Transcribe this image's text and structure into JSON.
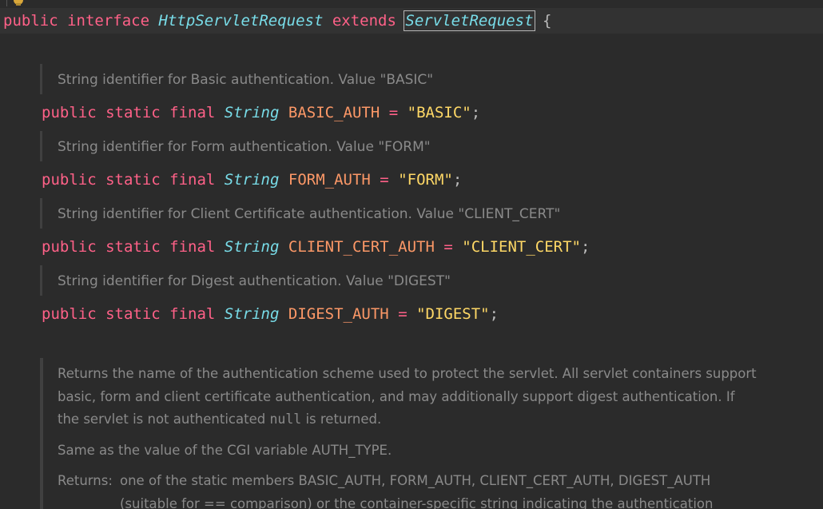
{
  "editor": {
    "declaration": {
      "kw_public": "public",
      "kw_interface": "interface",
      "name": "HttpServletRequest",
      "kw_extends": "extends",
      "parent": "ServletRequest",
      "brace": "{"
    },
    "fields": [
      {
        "doc": "String identifier for Basic authentication. Value \"BASIC\"",
        "mods": "public static final",
        "type": "String",
        "name": "BASIC_AUTH",
        "eq": "=",
        "value": "\"BASIC\"",
        "semi": ";"
      },
      {
        "doc": "String identifier for Form authentication. Value \"FORM\"",
        "mods": "public static final",
        "type": "String",
        "name": "FORM_AUTH",
        "eq": "=",
        "value": "\"FORM\"",
        "semi": ";"
      },
      {
        "doc": "String identifier for Client Certificate authentication. Value \"CLIENT_CERT\"",
        "mods": "public static final",
        "type": "String",
        "name": "CLIENT_CERT_AUTH",
        "eq": "=",
        "value": "\"CLIENT_CERT\"",
        "semi": ";"
      },
      {
        "doc": "String identifier for Digest authentication. Value \"DIGEST\"",
        "mods": "public static final",
        "type": "String",
        "name": "DIGEST_AUTH",
        "eq": "=",
        "value": "\"DIGEST\"",
        "semi": ";"
      }
    ],
    "method_doc": {
      "p1_line1": "Returns the name of the authentication scheme used to protect the servlet. All servlet containers support",
      "p1_line2": "basic, form and client certificate authentication, and may additionally support digest authentication. If",
      "p1_line3_a": "the servlet is not authenticated ",
      "p1_line3_code": "null",
      "p1_line3_b": " is returned.",
      "p2": "Same as the value of the CGI variable AUTH_TYPE.",
      "returns_label": "Returns:",
      "returns_line1": "one of the static members BASIC_AUTH, FORM_AUTH, CLIENT_CERT_AUTH, DIGEST_AUTH",
      "returns_line2": "(suitable for == comparison) or the container-specific string indicating the authentication"
    }
  }
}
